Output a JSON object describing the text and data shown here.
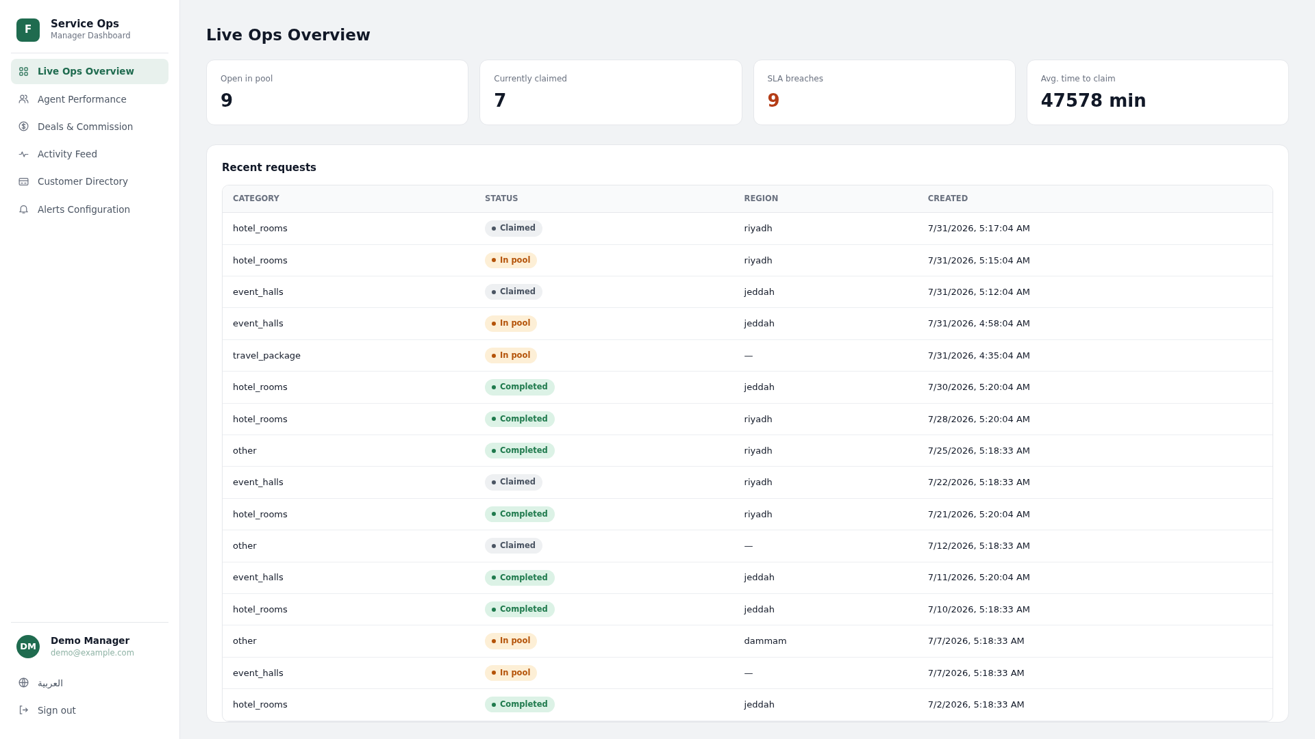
{
  "brand": {
    "logo": "F",
    "title": "Service Ops",
    "subtitle": "Manager Dashboard"
  },
  "nav": [
    {
      "label": "Live Ops Overview",
      "selected": true
    },
    {
      "label": "Agent Performance",
      "selected": false
    },
    {
      "label": "Deals & Commission",
      "selected": false
    },
    {
      "label": "Activity Feed",
      "selected": false
    },
    {
      "label": "Customer Directory",
      "selected": false
    },
    {
      "label": "Alerts Configuration",
      "selected": false
    }
  ],
  "user": {
    "initials": "DM",
    "name": "Demo Manager",
    "email": "demo@example.com"
  },
  "language": "العربية",
  "sign_out": "Sign out",
  "page_title": "Live Ops Overview",
  "stats": [
    {
      "label": "Open in pool",
      "value": "9",
      "alert": false
    },
    {
      "label": "Currently claimed",
      "value": "7",
      "alert": false
    },
    {
      "label": "SLA breaches",
      "value": "9",
      "alert": true
    },
    {
      "label": "Avg. time to claim",
      "value": "47578 min",
      "alert": false
    }
  ],
  "table": {
    "title": "Recent requests",
    "columns": [
      "CATEGORY",
      "STATUS",
      "REGION",
      "CREATED"
    ],
    "rows": [
      {
        "category": "hotel_rooms",
        "status": "Claimed",
        "kind": "claimed",
        "region": "riyadh",
        "created": "7/31/2026, 5:17:04 AM"
      },
      {
        "category": "hotel_rooms",
        "status": "In pool",
        "kind": "pool",
        "region": "riyadh",
        "created": "7/31/2026, 5:15:04 AM"
      },
      {
        "category": "event_halls",
        "status": "Claimed",
        "kind": "claimed",
        "region": "jeddah",
        "created": "7/31/2026, 5:12:04 AM"
      },
      {
        "category": "event_halls",
        "status": "In pool",
        "kind": "pool",
        "region": "jeddah",
        "created": "7/31/2026, 4:58:04 AM"
      },
      {
        "category": "travel_package",
        "status": "In pool",
        "kind": "pool",
        "region": "—",
        "created": "7/31/2026, 4:35:04 AM"
      },
      {
        "category": "hotel_rooms",
        "status": "Completed",
        "kind": "completed",
        "region": "jeddah",
        "created": "7/30/2026, 5:20:04 AM"
      },
      {
        "category": "hotel_rooms",
        "status": "Completed",
        "kind": "completed",
        "region": "riyadh",
        "created": "7/28/2026, 5:20:04 AM"
      },
      {
        "category": "other",
        "status": "Completed",
        "kind": "completed",
        "region": "riyadh",
        "created": "7/25/2026, 5:18:33 AM"
      },
      {
        "category": "event_halls",
        "status": "Claimed",
        "kind": "claimed",
        "region": "riyadh",
        "created": "7/22/2026, 5:18:33 AM"
      },
      {
        "category": "hotel_rooms",
        "status": "Completed",
        "kind": "completed",
        "region": "riyadh",
        "created": "7/21/2026, 5:20:04 AM"
      },
      {
        "category": "other",
        "status": "Claimed",
        "kind": "claimed",
        "region": "—",
        "created": "7/12/2026, 5:18:33 AM"
      },
      {
        "category": "event_halls",
        "status": "Completed",
        "kind": "completed",
        "region": "jeddah",
        "created": "7/11/2026, 5:20:04 AM"
      },
      {
        "category": "hotel_rooms",
        "status": "Completed",
        "kind": "completed",
        "region": "jeddah",
        "created": "7/10/2026, 5:18:33 AM"
      },
      {
        "category": "other",
        "status": "In pool",
        "kind": "pool",
        "region": "dammam",
        "created": "7/7/2026, 5:18:33 AM"
      },
      {
        "category": "event_halls",
        "status": "In pool",
        "kind": "pool",
        "region": "—",
        "created": "7/7/2026, 5:18:33 AM"
      },
      {
        "category": "hotel_rooms",
        "status": "Completed",
        "kind": "completed",
        "region": "jeddah",
        "created": "7/2/2026, 5:18:33 AM"
      }
    ]
  }
}
